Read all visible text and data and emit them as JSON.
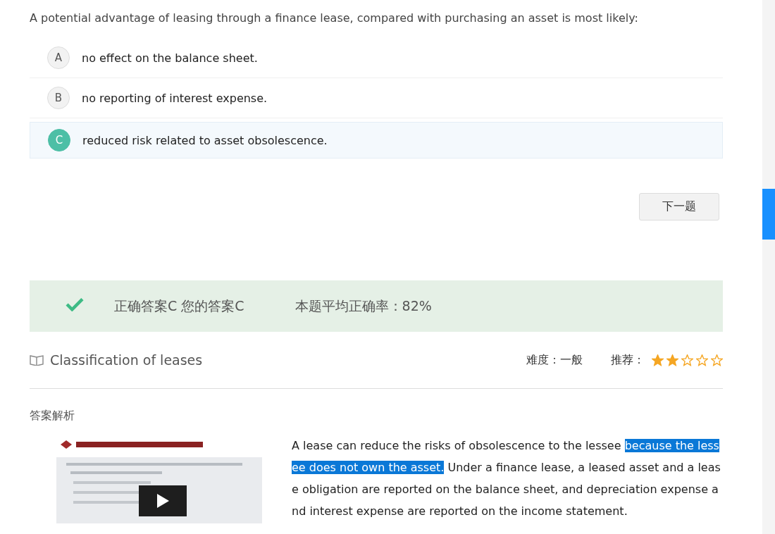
{
  "question": "A potential advantage of leasing through a finance lease, compared with purchasing an asset is most likely:",
  "options": [
    {
      "letter": "A",
      "text": "no effect on the balance sheet.",
      "selected": false
    },
    {
      "letter": "B",
      "text": "no reporting of interest expense.",
      "selected": false
    },
    {
      "letter": "C",
      "text": "reduced risk related to asset obsolescence.",
      "selected": true
    }
  ],
  "next_button": "下一题",
  "result": {
    "correct": true,
    "answers": "正确答案C 您的答案C",
    "average": "本题平均正确率：82%"
  },
  "topic": {
    "title": "Classification of leases",
    "difficulty": "难度：一般",
    "recommend_label": "推荐：",
    "stars": 2
  },
  "explanation": {
    "heading": "答案解析",
    "before": "A lease can reduce the risks of obsolescence to the lessee ",
    "highlighted": "because the lessee does not own the asset.",
    "after": " Under a finance lease, a leased asset and a lease obligation are reported on the balance sheet, and depreciation expense and interest expense are reported on the income statement."
  }
}
